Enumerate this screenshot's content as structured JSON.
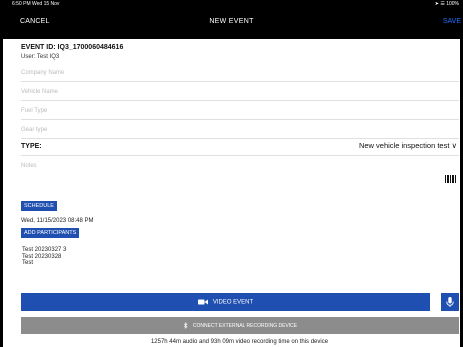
{
  "status_bar": {
    "time": "6:50 PM  Wed 15 Nov",
    "right": "➤ ☰ 100%"
  },
  "nav": {
    "cancel": "CANCEL",
    "title": "NEW EVENT",
    "save": "SAVE"
  },
  "event": {
    "id_line": "EVENT ID: IQ3_1700060484616",
    "user": "User: Test IQ3"
  },
  "fields": [
    {
      "placeholder": "Company Name"
    },
    {
      "placeholder": "Vehicle Name"
    },
    {
      "placeholder": "Fuel Type"
    },
    {
      "placeholder": "Gear type"
    }
  ],
  "type": {
    "label": "TYPE:",
    "value": "New vehicle inspection test ∨"
  },
  "notes": {
    "placeholder": "Notes"
  },
  "schedule": {
    "button": "SCHEDULE",
    "date": "Wed, 11/15/2023 08:48 PM"
  },
  "participants": {
    "button": "ADD PARTICIPANTS",
    "list": [
      "Test 20230327 3",
      "Test 20230328",
      "Test"
    ]
  },
  "actions": {
    "video_event": "VIDEO EVENT",
    "external_device": "CONNECT EXTERNAL RECORDING DEVICE",
    "recording_time": "1257h 44m audio and 93h 09m video recording time on this device"
  },
  "icons": [
    "video-camera-icon",
    "microphone-icon",
    "bluetooth-icon",
    "barcode-icon"
  ],
  "colors": {
    "primary": "#1f4fb0",
    "nav_bg": "#000000",
    "save": "#1e6fff",
    "disabled": "#8c8c8c"
  }
}
